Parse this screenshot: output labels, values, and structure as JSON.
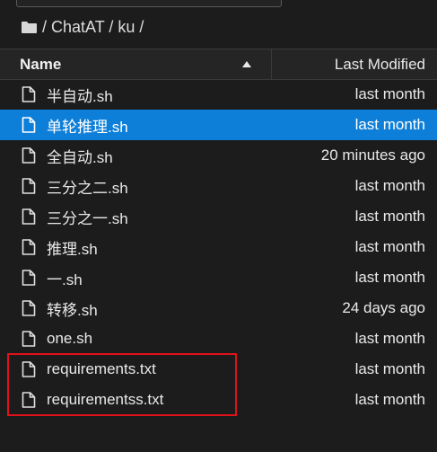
{
  "breadcrumb": {
    "text": "/ ChatAT / ku /",
    "icon": "folder-icon"
  },
  "header": {
    "name_label": "Name",
    "modified_label": "Last Modified",
    "sort_icon": "sort-up-icon"
  },
  "files": [
    {
      "name": "半自动.sh",
      "modified": "last month",
      "selected": false
    },
    {
      "name": "单轮推理.sh",
      "modified": "last month",
      "selected": true
    },
    {
      "name": "全自动.sh",
      "modified": "20 minutes ago",
      "selected": false
    },
    {
      "name": "三分之二.sh",
      "modified": "last month",
      "selected": false
    },
    {
      "name": "三分之一.sh",
      "modified": "last month",
      "selected": false
    },
    {
      "name": "推理.sh",
      "modified": "last month",
      "selected": false
    },
    {
      "name": "一.sh",
      "modified": "last month",
      "selected": false
    },
    {
      "name": "转移.sh",
      "modified": "24 days ago",
      "selected": false
    },
    {
      "name": "one.sh",
      "modified": "last month",
      "selected": false
    },
    {
      "name": "requirements.txt",
      "modified": "last month",
      "selected": false
    },
    {
      "name": "requirementss.txt",
      "modified": "last month",
      "selected": false
    }
  ],
  "colors": {
    "background": "#1c1c1c",
    "selection": "#0e7fd8",
    "highlight_box": "#e0121b"
  }
}
